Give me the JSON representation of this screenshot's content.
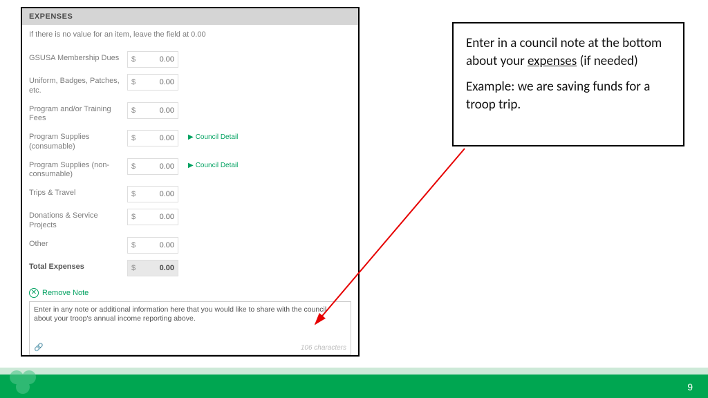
{
  "form": {
    "header": "EXPENSES",
    "instruction": "If there is no value for an item, leave the field at 0.00",
    "currency_symbol": "$",
    "rows": [
      {
        "label": "GSUSA Membership Dues",
        "value": "0.00",
        "detail": false
      },
      {
        "label": "Uniform, Badges, Patches, etc.",
        "value": "0.00",
        "detail": false
      },
      {
        "label": "Program and/or Training Fees",
        "value": "0.00",
        "detail": false
      },
      {
        "label": "Program Supplies (consumable)",
        "value": "0.00",
        "detail": true
      },
      {
        "label": "Program Supplies (non-consumable)",
        "value": "0.00",
        "detail": true
      },
      {
        "label": "Trips & Travel",
        "value": "0.00",
        "detail": false
      },
      {
        "label": "Donations & Service Projects",
        "value": "0.00",
        "detail": false
      },
      {
        "label": "Other",
        "value": "0.00",
        "detail": false
      }
    ],
    "detail_label": "Council Detail",
    "total_label": "Total Expenses",
    "total_value": "0.00",
    "remove_note_label": "Remove Note",
    "note_text": "Enter in any note or additional information here that you would like to share with the council about your troop's annual income reporting above.",
    "char_counter": "106 characters"
  },
  "callout": {
    "line1_pre": "Enter in a council note at the bottom about your ",
    "line1_underlined": "expenses",
    "line1_post": " (if needed)",
    "line2": "Example: we are saving funds for a troop trip."
  },
  "footer": {
    "page_number": "9"
  },
  "colors": {
    "accent": "#00a160",
    "footer": "#00a651",
    "arrow": "#e60000"
  }
}
